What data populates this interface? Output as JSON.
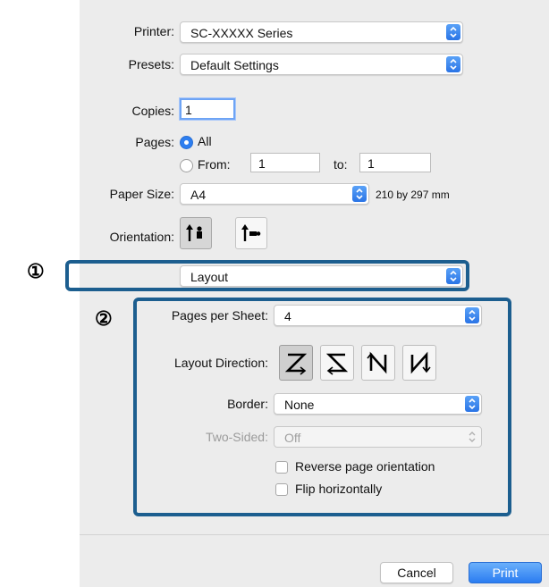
{
  "printer": {
    "label": "Printer:",
    "value": "SC-XXXXX Series"
  },
  "presets": {
    "label": "Presets:",
    "value": "Default Settings"
  },
  "copies": {
    "label": "Copies:",
    "value": "1"
  },
  "pages": {
    "label": "Pages:",
    "all_label": "All",
    "from_label": "From:",
    "from_value": "1",
    "to_label": "to:",
    "to_value": "1"
  },
  "paper_size": {
    "label": "Paper Size:",
    "value": "A4",
    "dimensions": "210 by 297 mm"
  },
  "orientation": {
    "label": "Orientation:"
  },
  "section_popup": {
    "value": "Layout"
  },
  "callouts": {
    "one": "①",
    "two": "②"
  },
  "layout": {
    "pages_per_sheet_label": "Pages per Sheet:",
    "pages_per_sheet_value": "4",
    "direction_label": "Layout Direction:",
    "border_label": "Border:",
    "border_value": "None",
    "two_sided_label": "Two-Sided:",
    "two_sided_value": "Off",
    "reverse_label": "Reverse page orientation",
    "flip_label": "Flip horizontally"
  },
  "buttons": {
    "cancel": "Cancel",
    "print": "Print"
  }
}
